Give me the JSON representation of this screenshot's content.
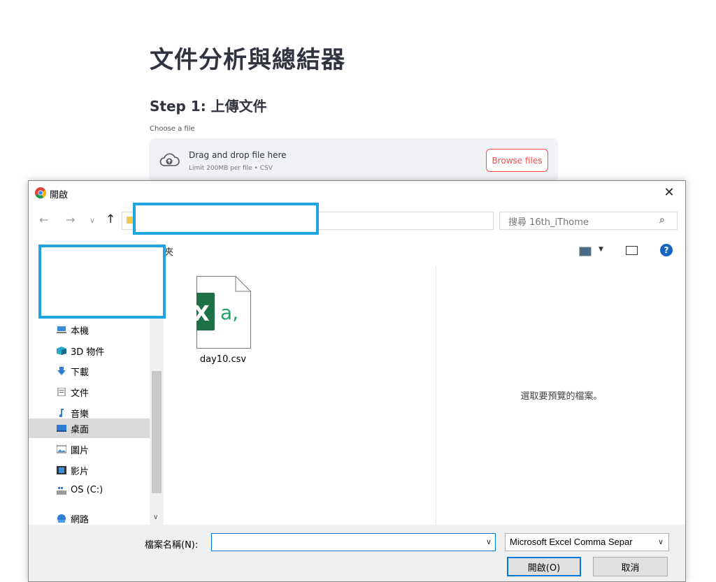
{
  "app": {
    "title": "文件分析與總結器",
    "step_title": "Step 1: 上傳文件",
    "uploader_label": "Choose a file",
    "dropzone_main": "Drag and drop file here",
    "dropzone_sub": "Limit 200MB per file • CSV",
    "browse_label": "Browse files",
    "accent_color": "#ff4b4b"
  },
  "dialog": {
    "title": "開啟",
    "close_glyph": "✕",
    "nav": {
      "back_glyph": "←",
      "forward_glyph": "→",
      "recent_glyph": "∨",
      "up_glyph": "↑",
      "address_drop_glyph": "∨",
      "refresh_glyph": "↻"
    },
    "search_placeholder": "搜尋 16th_iThome",
    "search_glyph": "⌕",
    "toolbar_partial_text": "夾",
    "help_glyph": "?",
    "nav_items": [
      {
        "label": "本機",
        "icon": "computer-icon"
      },
      {
        "label": "3D 物件",
        "icon": "3d-objects-icon"
      },
      {
        "label": "下載",
        "icon": "download-icon"
      },
      {
        "label": "文件",
        "icon": "document-icon"
      },
      {
        "label": "音樂",
        "icon": "music-icon"
      },
      {
        "label": "桌面",
        "icon": "desktop-icon",
        "selected": true
      },
      {
        "label": "圖片",
        "icon": "pictures-icon"
      },
      {
        "label": "影片",
        "icon": "videos-icon"
      },
      {
        "label": "OS (C:)",
        "icon": "drive-icon"
      },
      {
        "label": "網路",
        "icon": "network-icon"
      }
    ],
    "files": [
      {
        "name": "day10.csv",
        "icon": "excel-csv-icon",
        "badge": "X",
        "badge_suffix": "a,"
      }
    ],
    "preview_text": "選取要預覽的檔案。",
    "filename_label": "檔案名稱(N):",
    "filename_value": "",
    "filetype_value": "Microsoft Excel Comma Separ",
    "open_label": "開啟(O)",
    "cancel_label": "取消",
    "redaction_color": "#1fa4e0"
  }
}
